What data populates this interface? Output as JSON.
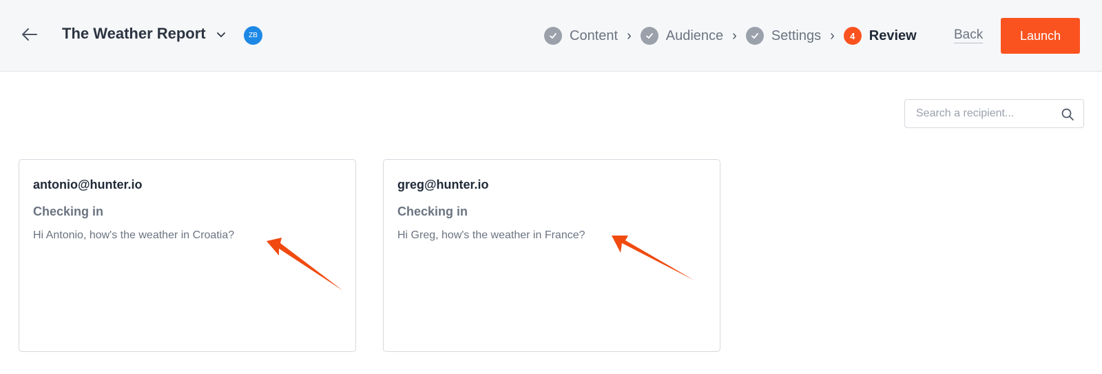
{
  "header": {
    "campaign_title": "The Weather Report",
    "owner_initials": "ZB",
    "steps": [
      {
        "label": "Content",
        "state": "done"
      },
      {
        "label": "Audience",
        "state": "done"
      },
      {
        "label": "Settings",
        "state": "done"
      },
      {
        "label": "Review",
        "state": "current",
        "number": "4"
      }
    ],
    "step_separator": "›",
    "back_label": "Back",
    "launch_label": "Launch"
  },
  "search": {
    "placeholder": "Search a recipient...",
    "value": ""
  },
  "recipients": [
    {
      "email": "antonio@hunter.io",
      "subject": "Checking in",
      "body": "Hi Antonio, how's the weather in Croatia?"
    },
    {
      "email": "greg@hunter.io",
      "subject": "Checking in",
      "body": "Hi Greg, how's the weather in France?"
    }
  ],
  "colors": {
    "accent": "#fa5320",
    "avatar": "#1e88e5",
    "step_done": "#9aa1ab",
    "header_bg": "#f6f7f9",
    "annotation_arrow": "#f04a10"
  },
  "icons": {
    "back": "arrow-left-icon",
    "title_dropdown": "chevron-down-icon",
    "step_done": "check-icon",
    "search": "search-icon",
    "annotation": "annotation-arrow-icon"
  }
}
